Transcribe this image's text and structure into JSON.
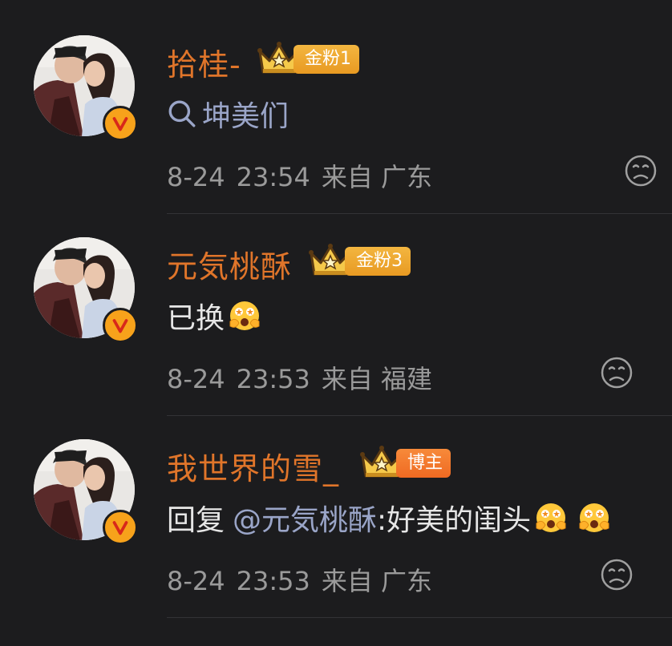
{
  "colors": {
    "background": "#1c1c1e",
    "username": "#e0752a",
    "content_text": "#e6e6e6",
    "link_text": "#9aa5c8",
    "meta_text": "#9a9a9a",
    "gold_badge": "#f3b640",
    "blogger_badge": "#f78a3a",
    "verified_badge": "#f7a21b"
  },
  "comments": [
    {
      "username": "拾桂-",
      "badge_icon": "crown-level-1-icon",
      "badge_label": "金粉1",
      "content_icon": "search-icon",
      "content_link": "坤美们",
      "date": "8-24",
      "time": "23:54",
      "location": "来自 广东",
      "reaction_icon": "sad-face-icon"
    },
    {
      "username": "元気桃酥",
      "badge_icon": "crown-level-1-icon",
      "badge_label": "金粉3",
      "content_text": "已换",
      "content_emoji": "hugging-face-icon",
      "date": "8-24",
      "time": "23:53",
      "location": "来自 福建",
      "reaction_icon": "sad-face-icon"
    },
    {
      "username": "我世界的雪_",
      "badge_icon": "crown-level-2-icon",
      "badge_label": "博主",
      "content_prefix": "回复",
      "content_mention": "@元気桃酥",
      "content_text": ":好美的闺头",
      "content_emoji": "hugging-face-icon",
      "date": "8-24",
      "time": "23:53",
      "location": "来自 广东",
      "reaction_icon": "sad-face-icon"
    }
  ]
}
